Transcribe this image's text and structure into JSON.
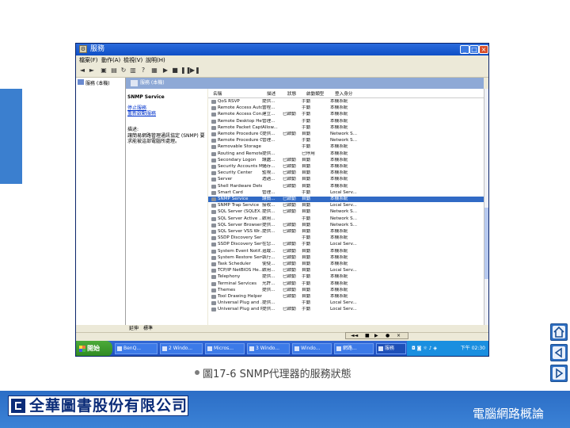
{
  "window": {
    "title": "服務",
    "menus": [
      "檔案(F)",
      "動作(A)",
      "檢視(V)",
      "說明(H)"
    ]
  },
  "tree": {
    "root_label": "服務 (本機)"
  },
  "pane": {
    "header": "服務 (本機)",
    "service_title": "SNMP Service",
    "link_stop": "停止服務",
    "link_restart": "重新啟動服務",
    "desc_heading": "描述:",
    "desc_body": "讓簡易網路管理通訊協定 (SNMP) 要求能被這部電腦所處理。"
  },
  "columns": [
    "名稱",
    "描述",
    "狀態",
    "啟動類型",
    "登入身分"
  ],
  "rows": [
    {
      "name": "QoS RSVP",
      "desc": "提供...",
      "status": "",
      "startup": "手動",
      "logon": "本機系統"
    },
    {
      "name": "Remote Access Auto...",
      "desc": "當程...",
      "status": "",
      "startup": "手動",
      "logon": "本機系統"
    },
    {
      "name": "Remote Access Con...",
      "desc": "建立...",
      "status": "已啟動",
      "startup": "手動",
      "logon": "本機系統"
    },
    {
      "name": "Remote Desktop Hel...",
      "desc": "管理...",
      "status": "",
      "startup": "手動",
      "logon": "本機系統"
    },
    {
      "name": "Remote Packet Capt...",
      "desc": "Allow...",
      "status": "",
      "startup": "手動",
      "logon": "本機系統"
    },
    {
      "name": "Remote Procedure C...",
      "desc": "提供...",
      "status": "已啟動",
      "startup": "自動",
      "logon": "Network S..."
    },
    {
      "name": "Remote Procedure C...",
      "desc": "管理...",
      "status": "",
      "startup": "手動",
      "logon": "Network S..."
    },
    {
      "name": "Removable Storage",
      "desc": "",
      "status": "",
      "startup": "手動",
      "logon": "本機系統"
    },
    {
      "name": "Routing and Remote...",
      "desc": "提供...",
      "status": "",
      "startup": "已停用",
      "logon": "本機系統"
    },
    {
      "name": "Secondary Logon",
      "desc": "讓處...",
      "status": "已啟動",
      "startup": "自動",
      "logon": "本機系統"
    },
    {
      "name": "Security Accounts M...",
      "desc": "儲存...",
      "status": "已啟動",
      "startup": "自動",
      "logon": "本機系統"
    },
    {
      "name": "Security Center",
      "desc": "監視...",
      "status": "已啟動",
      "startup": "自動",
      "logon": "本機系統"
    },
    {
      "name": "Server",
      "desc": "透過...",
      "status": "已啟動",
      "startup": "自動",
      "logon": "本機系統"
    },
    {
      "name": "Shell Hardware Dete...",
      "desc": "",
      "status": "已啟動",
      "startup": "自動",
      "logon": "本機系統"
    },
    {
      "name": "Smart Card",
      "desc": "管理...",
      "status": "",
      "startup": "手動",
      "logon": "Local Serv..."
    },
    {
      "name": "SNMP Service",
      "desc": "讓簡...",
      "status": "已啟動",
      "startup": "自動",
      "logon": "本機系統",
      "selected": true
    },
    {
      "name": "SNMP Trap Service",
      "desc": "接收...",
      "status": "已啟動",
      "startup": "自動",
      "logon": "Local Serv..."
    },
    {
      "name": "SQL Server (SQLEX...",
      "desc": "提供...",
      "status": "已啟動",
      "startup": "自動",
      "logon": "Network S..."
    },
    {
      "name": "SQL Server Active ...",
      "desc": "啟用...",
      "status": "",
      "startup": "手動",
      "logon": "Network S..."
    },
    {
      "name": "SQL Server Browser",
      "desc": "提供...",
      "status": "已啟動",
      "startup": "自動",
      "logon": "Network S..."
    },
    {
      "name": "SQL Server VSS Wr...",
      "desc": "提供...",
      "status": "已啟動",
      "startup": "自動",
      "logon": "本機系統"
    },
    {
      "name": "SSDP Discovery Serv...",
      "desc": "",
      "status": "",
      "startup": "手動",
      "logon": "本機系統"
    },
    {
      "name": "SSDP Discovery Serv...",
      "desc": "在您...",
      "status": "已啟動",
      "startup": "手動",
      "logon": "Local Serv..."
    },
    {
      "name": "System Event Notif...",
      "desc": "追蹤...",
      "status": "已啟動",
      "startup": "自動",
      "logon": "本機系統"
    },
    {
      "name": "System Restore Serv...",
      "desc": "執行...",
      "status": "已啟動",
      "startup": "自動",
      "logon": "本機系統"
    },
    {
      "name": "Task Scheduler",
      "desc": "使使...",
      "status": "已啟動",
      "startup": "自動",
      "logon": "本機系統"
    },
    {
      "name": "TCP/IP NetBIOS He...",
      "desc": "啟用...",
      "status": "已啟動",
      "startup": "自動",
      "logon": "Local Serv..."
    },
    {
      "name": "Telephony",
      "desc": "提供...",
      "status": "已啟動",
      "startup": "手動",
      "logon": "本機系統"
    },
    {
      "name": "Terminal Services",
      "desc": "允許...",
      "status": "已啟動",
      "startup": "手動",
      "logon": "本機系統"
    },
    {
      "name": "Themes",
      "desc": "提供...",
      "status": "已啟動",
      "startup": "自動",
      "logon": "本機系統"
    },
    {
      "name": "Tool Drawing Helper",
      "desc": "",
      "status": "已啟動",
      "startup": "自動",
      "logon": "本機系統"
    },
    {
      "name": "Universal Plug and ...",
      "desc": "提供...",
      "status": "",
      "startup": "手動",
      "logon": "Local Serv..."
    },
    {
      "name": "Universal Plug and P...",
      "desc": "提供...",
      "status": "已啟動",
      "startup": "手動",
      "logon": "Local Serv..."
    }
  ],
  "tabs": [
    "延伸",
    "標準"
  ],
  "taskbar": {
    "start": "開始",
    "tasks": [
      "BenQ...",
      "2 Windo...",
      "Micros...",
      "3 Windo...",
      "Windo...",
      "網路...",
      "服務"
    ],
    "clock": "下午 02:30"
  },
  "caption": "圖17-6 SNMP代理器的服務狀態",
  "footer": {
    "publisher": "全華圖書股份有限公司",
    "course": "電腦網路概論"
  }
}
